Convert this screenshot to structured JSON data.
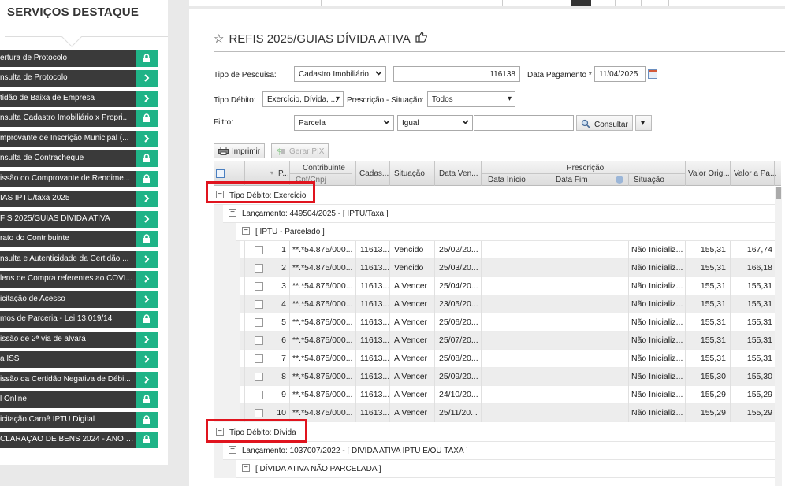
{
  "sidebar": {
    "title": "SERVIÇOS DESTAQUE",
    "items": [
      {
        "label": "ertura de Protocolo",
        "icon": "lock-icon"
      },
      {
        "label": "nsulta de Protocolo",
        "icon": "chevron-right-icon"
      },
      {
        "label": "tidão de Baixa de Empresa",
        "icon": "chevron-right-icon"
      },
      {
        "label": "nsulta Cadastro Imobiliário x Propri...",
        "icon": "lock-icon"
      },
      {
        "label": "mprovante de Inscrição Municipal (...",
        "icon": "chevron-right-icon"
      },
      {
        "label": "nsulta de Contracheque",
        "icon": "lock-icon"
      },
      {
        "label": "issão do Comprovante de Rendime...",
        "icon": "lock-icon"
      },
      {
        "label": "IAS IPTU/taxa 2025",
        "icon": "chevron-right-icon"
      },
      {
        "label": "FIS 2025/GUIAS DÍVIDA ATIVA",
        "icon": "chevron-right-icon"
      },
      {
        "label": "rato do Contribuinte",
        "icon": "lock-icon"
      },
      {
        "label": "nsulta e Autenticidade da Certidão ...",
        "icon": "chevron-right-icon"
      },
      {
        "label": "lens de Compra referentes ao COVI...",
        "icon": "chevron-right-icon"
      },
      {
        "label": "icitação de Acesso",
        "icon": "chevron-right-icon"
      },
      {
        "label": "mos de Parceria - Lei 13.019/14",
        "icon": "lock-icon"
      },
      {
        "label": "issão de 2ª via de alvará",
        "icon": "chevron-right-icon"
      },
      {
        "label": "a ISS",
        "icon": "chevron-right-icon"
      },
      {
        "label": "issão da Certidão Negativa de Débi...",
        "icon": "chevron-right-icon"
      },
      {
        "label": "l Online",
        "icon": "lock-icon"
      },
      {
        "label": "icitação Carnê IPTU Digital",
        "icon": "lock-icon"
      },
      {
        "label": "CLARAÇÃO DE BENS 2024 - ANO B...",
        "icon": "lock-icon"
      }
    ]
  },
  "page": {
    "title": "REFIS 2025/GUIAS DÍVIDA ATIVA"
  },
  "form": {
    "tipo_pesquisa_label": "Tipo de Pesquisa:",
    "tipo_pesquisa_value": "Cadastro Imobiliário",
    "cadastro_value": "116138",
    "data_pagamento_label": "Data Pagamento *",
    "data_pagamento_value": "11/04/2025",
    "tipo_debito_label": "Tipo Débito:",
    "tipo_debito_value": "Exercício, Dívida, ...",
    "prescricao_label": "Prescrição - Situação:",
    "prescricao_value": "Todos",
    "filtro_label": "Filtro:",
    "filtro_campo": "Parcela",
    "filtro_operador": "Igual",
    "filtro_valor": "",
    "consultar_label": "Consultar"
  },
  "toolbar": {
    "imprimir_label": "Imprimir",
    "gerar_pix_label": "Gerar PIX"
  },
  "grid": {
    "headers": {
      "p": "P...",
      "contribuinte": "Contribuinte",
      "cpf_cnpj": "Cpf/Cnpj",
      "cadastro": "Cadas...",
      "situacao": "Situação",
      "data_venc": "Data Ven...",
      "prescricao": "Prescrição",
      "data_inicio": "Data Início",
      "data_fim": "Data Fim",
      "presc_situacao": "Situação",
      "valor_orig": "Valor Orig...",
      "valor_pagar": "Valor a Pa..."
    },
    "group1": {
      "tipo_debito": "Tipo Débito: Exercício",
      "lancamento": "Lançamento: 449504/2025 - [ IPTU/Taxa ]",
      "subgroup": "[ IPTU - Parcelado ]"
    },
    "rows": [
      {
        "p": "1",
        "cpf": "**.*54.875/000...",
        "cad": "11613...",
        "sit": "Vencido",
        "venc": "25/02/20...",
        "psit": "Não Inicializ...",
        "orig": "155,31",
        "pagar": "167,74"
      },
      {
        "p": "2",
        "cpf": "**.*54.875/000...",
        "cad": "11613...",
        "sit": "Vencido",
        "venc": "25/03/20...",
        "psit": "Não Inicializ...",
        "orig": "155,31",
        "pagar": "166,18"
      },
      {
        "p": "3",
        "cpf": "**.*54.875/000...",
        "cad": "11613...",
        "sit": "A Vencer",
        "venc": "25/04/20...",
        "psit": "Não Inicializ...",
        "orig": "155,31",
        "pagar": "155,31"
      },
      {
        "p": "4",
        "cpf": "**.*54.875/000...",
        "cad": "11613...",
        "sit": "A Vencer",
        "venc": "23/05/20...",
        "psit": "Não Inicializ...",
        "orig": "155,31",
        "pagar": "155,31"
      },
      {
        "p": "5",
        "cpf": "**.*54.875/000...",
        "cad": "11613...",
        "sit": "A Vencer",
        "venc": "25/06/20...",
        "psit": "Não Inicializ...",
        "orig": "155,31",
        "pagar": "155,31"
      },
      {
        "p": "6",
        "cpf": "**.*54.875/000...",
        "cad": "11613...",
        "sit": "A Vencer",
        "venc": "25/07/20...",
        "psit": "Não Inicializ...",
        "orig": "155,31",
        "pagar": "155,31"
      },
      {
        "p": "7",
        "cpf": "**.*54.875/000...",
        "cad": "11613...",
        "sit": "A Vencer",
        "venc": "25/08/20...",
        "psit": "Não Inicializ...",
        "orig": "155,31",
        "pagar": "155,31"
      },
      {
        "p": "8",
        "cpf": "**.*54.875/000...",
        "cad": "11613...",
        "sit": "A Vencer",
        "venc": "25/09/20...",
        "psit": "Não Inicializ...",
        "orig": "155,30",
        "pagar": "155,30"
      },
      {
        "p": "9",
        "cpf": "**.*54.875/000...",
        "cad": "11613...",
        "sit": "A Vencer",
        "venc": "24/10/20...",
        "psit": "Não Inicializ...",
        "orig": "155,29",
        "pagar": "155,29"
      },
      {
        "p": "10",
        "cpf": "**.*54.875/000...",
        "cad": "11613...",
        "sit": "A Vencer",
        "venc": "25/11/20...",
        "psit": "Não Inicializ...",
        "orig": "155,29",
        "pagar": "155,29"
      }
    ],
    "group2": {
      "tipo_debito": "Tipo Débito: Dívida",
      "lancamento": "Lançamento: 1037007/2022 - [ DIVIDA ATIVA IPTU E/OU TAXA ]",
      "subgroup": "[ DÍVIDA ATIVA NÃO PARCELADA ]"
    }
  },
  "colors": {
    "sidebar_item_bg": "#3a3a3a",
    "badge_green": "#1fb387",
    "highlight_red": "#e0141e"
  }
}
